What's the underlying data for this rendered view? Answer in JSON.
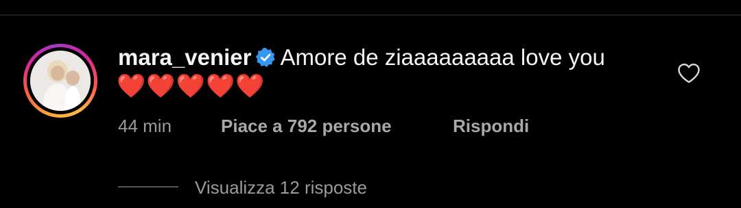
{
  "comment": {
    "username": "mara_venier",
    "verified": true,
    "text": "Amore de ziaaaaaaaaa love you",
    "emoji": "❤️❤️❤️❤️❤️",
    "time": "44 min",
    "likes_label": "Piace a 792 persone",
    "reply_label": "Rispondi",
    "view_replies_label": "Visualizza 12 risposte"
  },
  "icons": {
    "verified": "verified-badge-icon",
    "like": "heart-outline-icon"
  },
  "colors": {
    "background": "#000000",
    "verified_badge": "#3797f0",
    "secondary_text": "#9b9b9b",
    "heart": "#ed1c24"
  }
}
